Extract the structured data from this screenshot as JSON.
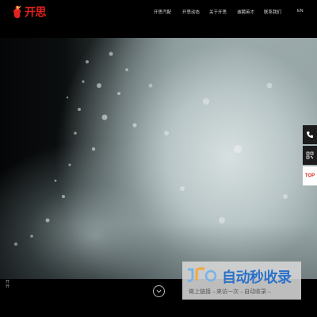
{
  "header": {
    "logo_text": "开思",
    "nav": [
      {
        "label": "开思汽配"
      },
      {
        "label": "开思动态"
      },
      {
        "label": "关于开思"
      },
      {
        "label": "诚聘英才"
      },
      {
        "label": "联系我们"
      },
      {
        "label": "EN"
      }
    ]
  },
  "side_tools": {
    "top_label": "TOP"
  },
  "footer": {
    "vertical_text": "开\n开"
  },
  "watermark": {
    "title": "自动秒收录",
    "subtitle": "做上链接→来访一次→自动收录→"
  },
  "colors": {
    "brand": "#e1221f",
    "watermark_blue": "#2c72c9",
    "background": "#000000"
  }
}
